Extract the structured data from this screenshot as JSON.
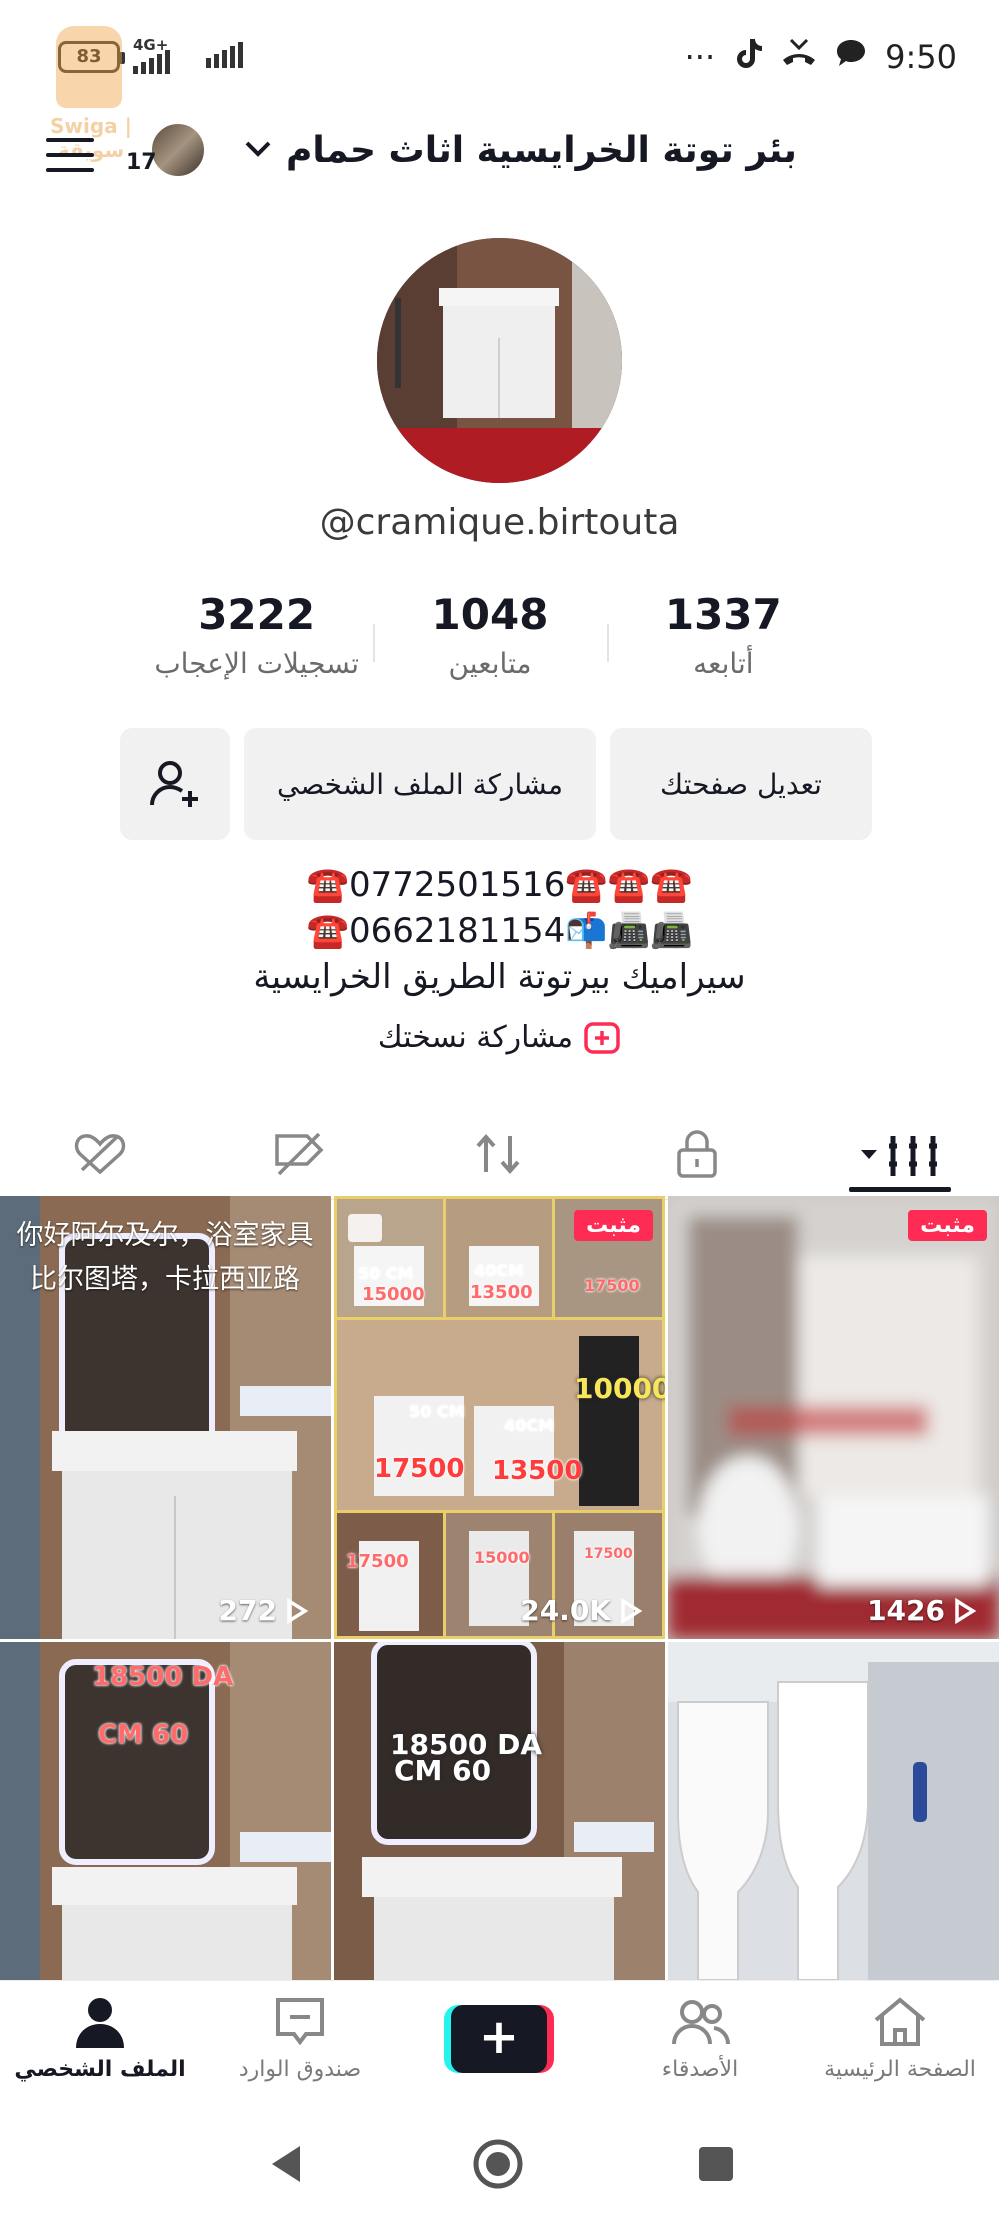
{
  "status_bar": {
    "battery": "83",
    "network_type": "4G+",
    "time": "9:50",
    "more_label": "···",
    "icons": [
      "tiktok-icon",
      "missed-call-icon",
      "message-bubble-icon"
    ]
  },
  "watermark": {
    "text": "Swiga | سويقة"
  },
  "header": {
    "title": "بئر توتة الخرايسية اثاث حمام",
    "story_count": "17"
  },
  "profile": {
    "username": "@cramique.birtouta",
    "stats": [
      {
        "value": "1337",
        "label": "أتابعه"
      },
      {
        "value": "1048",
        "label": "متابعين"
      },
      {
        "value": "3222",
        "label": "تسجيلات الإعجاب"
      }
    ],
    "buttons": {
      "edit": "تعديل صفحتك",
      "share": "مشاركة الملف الشخصي"
    },
    "bio": {
      "line1": "☎️0772501516☎️☎️☎️",
      "line2": "☎️0662181154📬📠📠",
      "line3": "سيراميك بيرتوتة الطريق الخرايسية"
    },
    "share_copy": "مشاركة نسختك"
  },
  "tabs": [
    "videos-grid-icon",
    "lock-icon",
    "repost-icon",
    "tagged-icon",
    "liked-icon"
  ],
  "grid": {
    "pinned_label": "مثبت",
    "items": [
      {
        "views": "272",
        "caption": "你好阿尔及尔，浴室家具\n比尔图塔，卡拉西亚路"
      },
      {
        "views": "24.0K",
        "pinned": true,
        "prices": [
          "50 CM",
          "15000",
          "40CM",
          "13500",
          "17500",
          "10000",
          "50 CM",
          "40CM",
          "17500",
          "13500",
          "17500",
          "15000",
          "17500"
        ]
      },
      {
        "views": "1426",
        "pinned": true
      },
      {
        "price_line1": "18500 DA",
        "price_line2": "CM 60"
      },
      {
        "price_line1": "18500 DA",
        "price_line2": "CM 60"
      },
      {}
    ]
  },
  "bottom_nav": {
    "home": "الصفحة الرئيسية",
    "friends": "الأصدقاء",
    "inbox": "صندوق الوارد",
    "profile": "الملف الشخصي"
  }
}
